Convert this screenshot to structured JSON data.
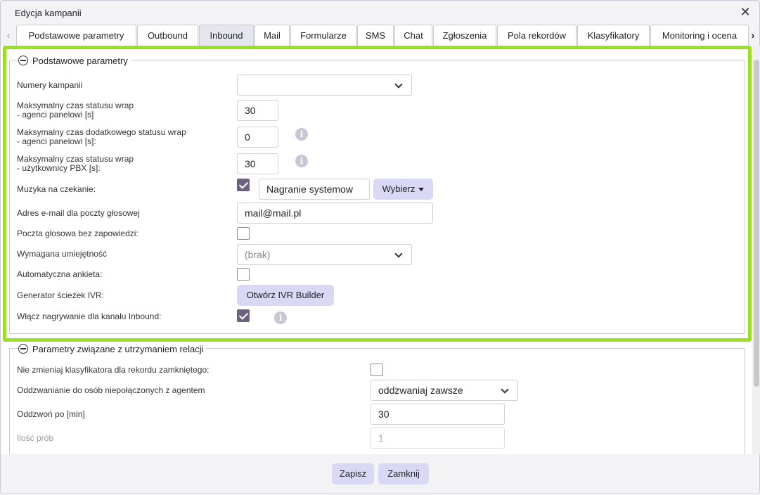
{
  "window": {
    "title": "Edycja kampanii"
  },
  "tabs": [
    {
      "label": "Podstawowe parametry"
    },
    {
      "label": "Outbound"
    },
    {
      "label": "Inbound"
    },
    {
      "label": "Mail"
    },
    {
      "label": "Formularze"
    },
    {
      "label": "SMS"
    },
    {
      "label": "Chat"
    },
    {
      "label": "Zgłoszenia"
    },
    {
      "label": "Pola rekordów"
    },
    {
      "label": "Klasyfikatory"
    },
    {
      "label": "Monitoring i ocena"
    }
  ],
  "active_tab": "Inbound",
  "section1": {
    "title": "Podstawowe parametry",
    "numery_label": "Numery kampanii",
    "numery_value": "",
    "wrap_label_1": "Maksymalny czas statusu wrap",
    "wrap_label_2": "- agenci panelowi [s]",
    "wrap_value": "30",
    "addwrap_label_1": "Maksymalny czas dodatkowego statusu wrap",
    "addwrap_label_2": "- agenci panelowi [s]:",
    "addwrap_value": "0",
    "pbx_label_1": "Maksymalny czas statusu wrap",
    "pbx_label_2": "- użytkownicy PBX [s]:",
    "pbx_value": "30",
    "music_label": "Muzyka na czekanie:",
    "music_checked": true,
    "music_value": "Nagranie systemow",
    "music_button": "Wybierz",
    "email_label": "Adres e-mail dla poczty głosowej",
    "email_value": "mail@mail.pl",
    "voicemail_label": "Poczta głosowa bez zapowiedzi:",
    "voicemail_checked": false,
    "skill_label": "Wymagana umiejętność",
    "skill_value": "(brak)",
    "survey_label": "Automatyczna ankieta:",
    "survey_checked": false,
    "ivr_label": "Generator ścieżek IVR:",
    "ivr_button": "Otwórz IVR Builder",
    "record_label": "Włącz nagrywanie dla kanału Inbound:",
    "record_checked": true
  },
  "section2": {
    "title": "Parametry związane z utrzymaniem relacji",
    "classifier_label": "Nie zmieniaj klasyfikatora dla rekordu zamkniętego:",
    "classifier_checked": false,
    "callback_label": "Oddzwanianie do osób niepołączonych z agentem",
    "callback_value": "oddzwaniaj zawsze",
    "callback_after_label": "Oddzwoń po [min]",
    "callback_after_value": "30",
    "attempts_label": "Ilość prób",
    "attempts_value": "1"
  },
  "footer": {
    "save": "Zapisz",
    "close": "Zamknij"
  },
  "info_glyph": "i",
  "colors": {
    "highlight": "#9be023",
    "button": "#d9d9f5",
    "checkbox": "#6c617f"
  }
}
